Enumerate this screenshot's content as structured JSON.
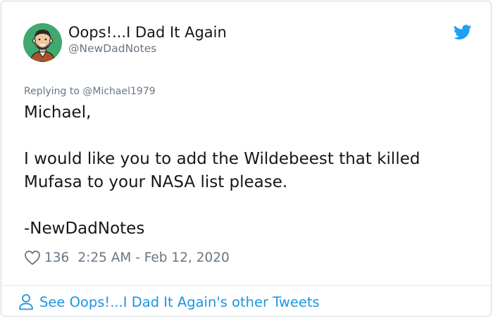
{
  "tweet": {
    "author": {
      "display_name": "Oops!...I Dad It Again",
      "handle": "@NewDadNotes",
      "avatar_icon": "cartoon-man-avatar"
    },
    "brand_icon": "twitter-bird-icon",
    "replying_to": "Replying to @Michael1979",
    "body_lines": [
      "Michael,",
      "",
      "I would like you to add the Wildebeest that killed",
      "Mufasa to your NASA list please.",
      "",
      "-NewDadNotes"
    ],
    "like_count": "136",
    "timestamp": "2:25 AM - Feb 12, 2020",
    "footer_link": "See Oops!...I Dad It Again's other Tweets"
  },
  "colors": {
    "brand_blue": "#1b95e0",
    "secondary_text": "#687684",
    "border": "#cfd9de",
    "avatar_bg": "#3fa96e"
  }
}
